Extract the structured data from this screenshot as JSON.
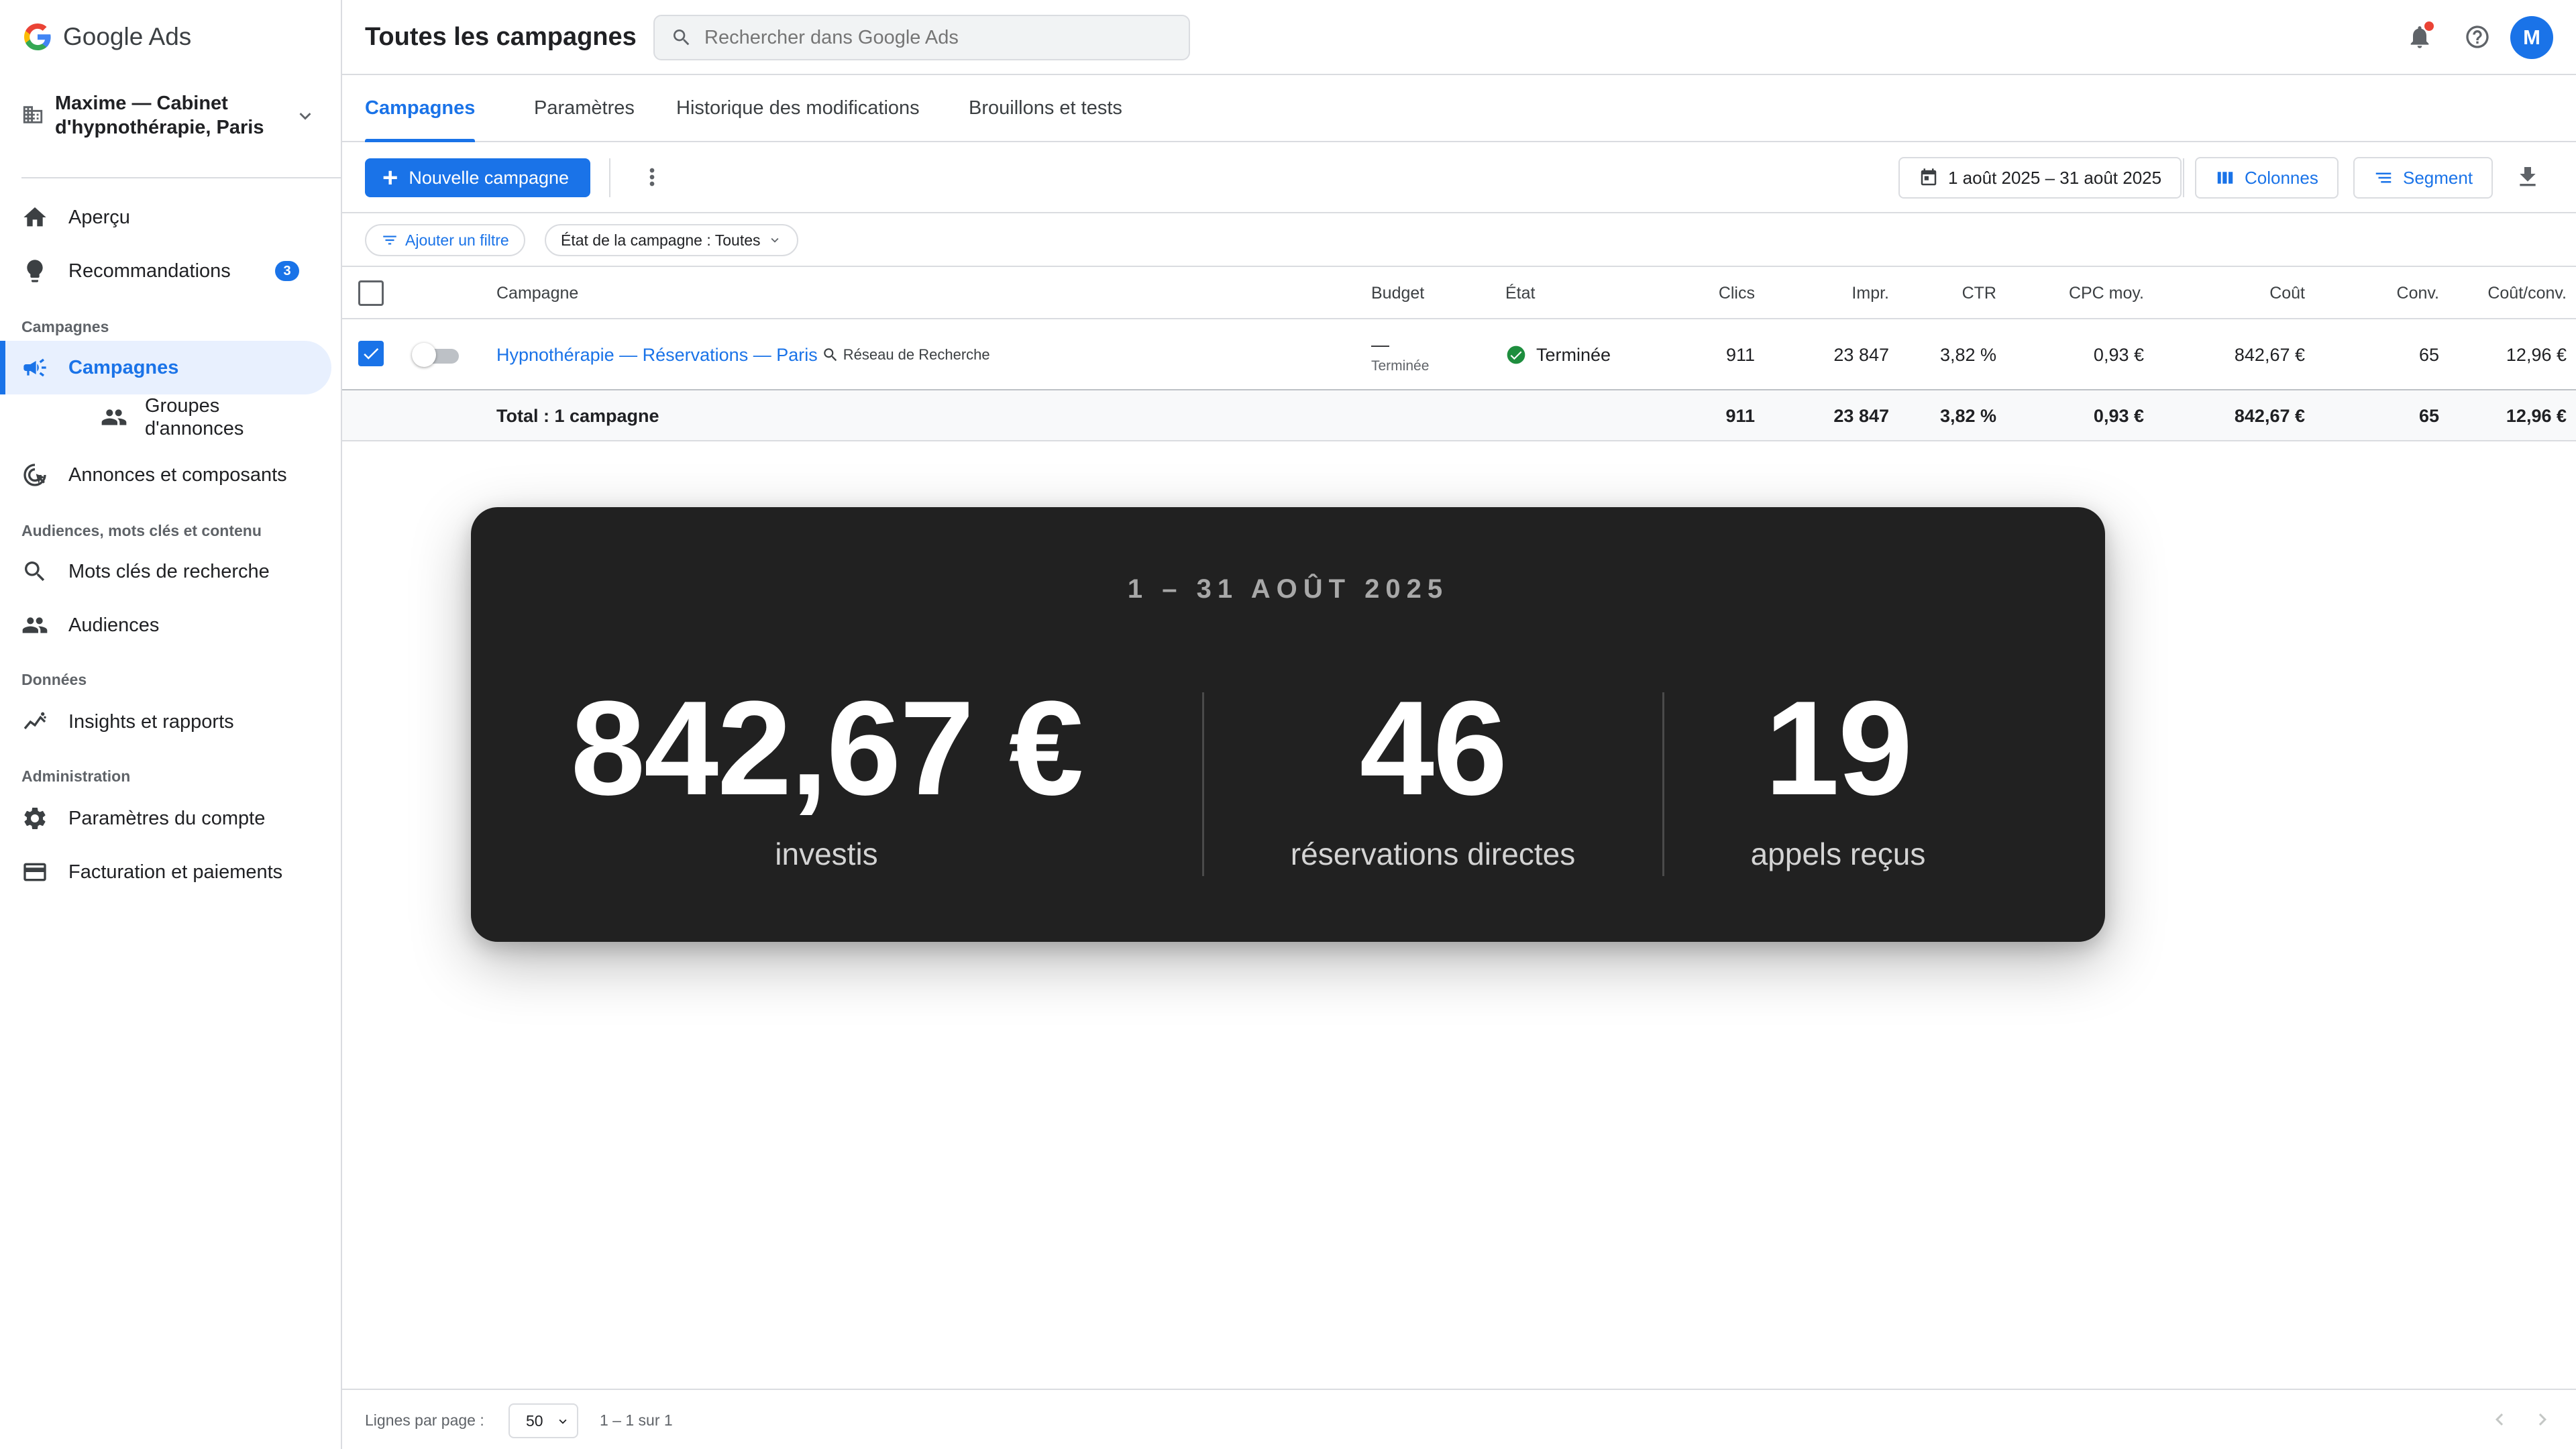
{
  "brand": {
    "name": "Google Ads"
  },
  "account": {
    "name": "Maxime — Cabinet d'hypnothérapie, Paris"
  },
  "sidebar": {
    "items": [
      {
        "label": "Aperçu",
        "icon": "home-icon"
      },
      {
        "label": "Recommandations",
        "icon": "lightbulb-icon",
        "badge": "3"
      },
      {
        "label": "Campagnes",
        "icon": "campaign-icon",
        "active": true
      },
      {
        "label": "Groupes d'annonces",
        "icon": "groups-icon"
      },
      {
        "label": "Annonces et composants",
        "icon": "ads-icon"
      },
      {
        "label": "Mots clés de recherche",
        "icon": "search-icon"
      },
      {
        "label": "Audiences",
        "icon": "audiences-icon"
      },
      {
        "label": "Insights et rapports",
        "icon": "insights-icon"
      },
      {
        "label": "Paramètres du compte",
        "icon": "gear-icon"
      },
      {
        "label": "Facturation et paiements",
        "icon": "credit-card-icon"
      }
    ],
    "sections": {
      "campaigns": "Campagnes",
      "audiences": "Audiences, mots clés et contenu",
      "data": "Données",
      "admin": "Administration"
    }
  },
  "header": {
    "title": "Toutes les campagnes",
    "search_placeholder": "Rechercher dans Google Ads",
    "avatar_initial": "M"
  },
  "tabs": [
    {
      "label": "Campagnes",
      "active": true
    },
    {
      "label": "Paramètres"
    },
    {
      "label": "Historique des modifications"
    },
    {
      "label": "Brouillons et tests"
    }
  ],
  "toolbar": {
    "new_campaign": "Nouvelle campagne",
    "date_range": "1 août 2025 – 31 août 2025",
    "columns": "Colonnes",
    "segment": "Segment"
  },
  "filters": {
    "add_filter": "Ajouter un filtre",
    "status_filter": "État de la campagne : Toutes"
  },
  "table": {
    "columns": [
      "Campagne",
      "Budget",
      "État",
      "Clics",
      "Impr.",
      "CTR",
      "CPC moy.",
      "Coût",
      "Conv.",
      "Coût/conv."
    ],
    "rows": [
      {
        "campaign": "Hypnothérapie — Réservations — Paris",
        "type": "Réseau de Recherche",
        "budget": "—",
        "budget_note": "Terminée",
        "status": "Terminée",
        "clicks": "911",
        "impressions": "23 847",
        "ctr": "3,82 %",
        "cpc": "0,93 €",
        "cost": "842,67 €",
        "conversions": "65",
        "cost_per_conv": "12,96 €",
        "selected": true,
        "enabled": false
      }
    ],
    "total": {
      "label": "Total : 1 campagne",
      "clicks": "911",
      "impressions": "23 847",
      "ctr": "3,82 %",
      "cpc": "0,93 €",
      "cost": "842,67 €",
      "conversions": "65",
      "cost_per_conv": "12,96 €"
    }
  },
  "overlay": {
    "date": "1 – 31 AOÛT 2025",
    "stats": [
      {
        "value": "842,67 €",
        "label": "investis"
      },
      {
        "value": "46",
        "label": "réservations directes"
      },
      {
        "value": "19",
        "label": "appels reçus"
      }
    ]
  },
  "footer": {
    "rows_per_page_label": "Lignes par page :",
    "rows_per_page": "50",
    "range": "1 – 1 sur 1"
  },
  "colors": {
    "accent": "#1a73e8",
    "success": "#1e8e3e",
    "overlay_bg": "#212121",
    "notification": "#ea4335"
  }
}
